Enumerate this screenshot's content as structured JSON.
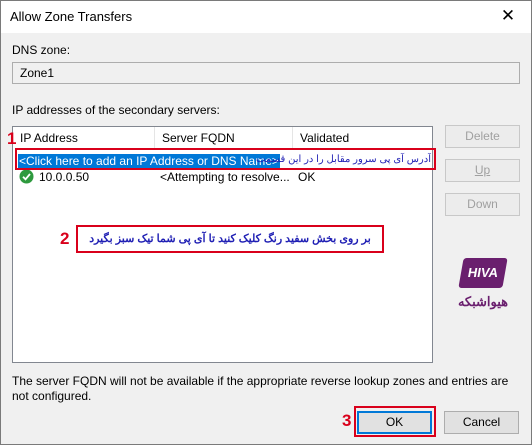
{
  "window": {
    "title": "Allow Zone Transfers",
    "close_glyph": "✕"
  },
  "dns_zone": {
    "label": "DNS zone:",
    "value": "Zone1"
  },
  "servers": {
    "label": "IP addresses of the secondary servers:"
  },
  "table": {
    "headers": [
      "IP Address",
      "Server FQDN",
      "Validated"
    ],
    "add_row_text": "<Click here to add an IP Address or DNS Name>",
    "rows": [
      {
        "ip": "10.0.0.50",
        "fqdn": "<Attempting to resolve...",
        "validated": "OK",
        "status_icon": "check-circle-icon"
      }
    ]
  },
  "side_buttons": {
    "delete": {
      "label": "Delete",
      "enabled": false
    },
    "up": {
      "label": "Up",
      "enabled": false
    },
    "down": {
      "label": "Down",
      "enabled": false
    }
  },
  "note": "The server FQDN will not be available if the appropriate reverse lookup zones and entries are not configured.",
  "footer": {
    "ok": "OK",
    "cancel": "Cancel"
  },
  "annotations": {
    "step1_number": "1",
    "step1_text": "آدرس آی پی سرور مقابل را در این قسمت وارد کنید",
    "step2_number": "2",
    "step2_text": "بر روی بخش سفید رنگ کلیک کنید تا آی پی شما تیک سبز بگیرد",
    "step3_number": "3",
    "highlight_color": "#d9001b",
    "annotation_text_color": "#1f1fb4"
  },
  "watermark": {
    "logo_text": "HIVA",
    "brand_text": "هیواشبکه",
    "brand_color": "#6a1f6e"
  }
}
